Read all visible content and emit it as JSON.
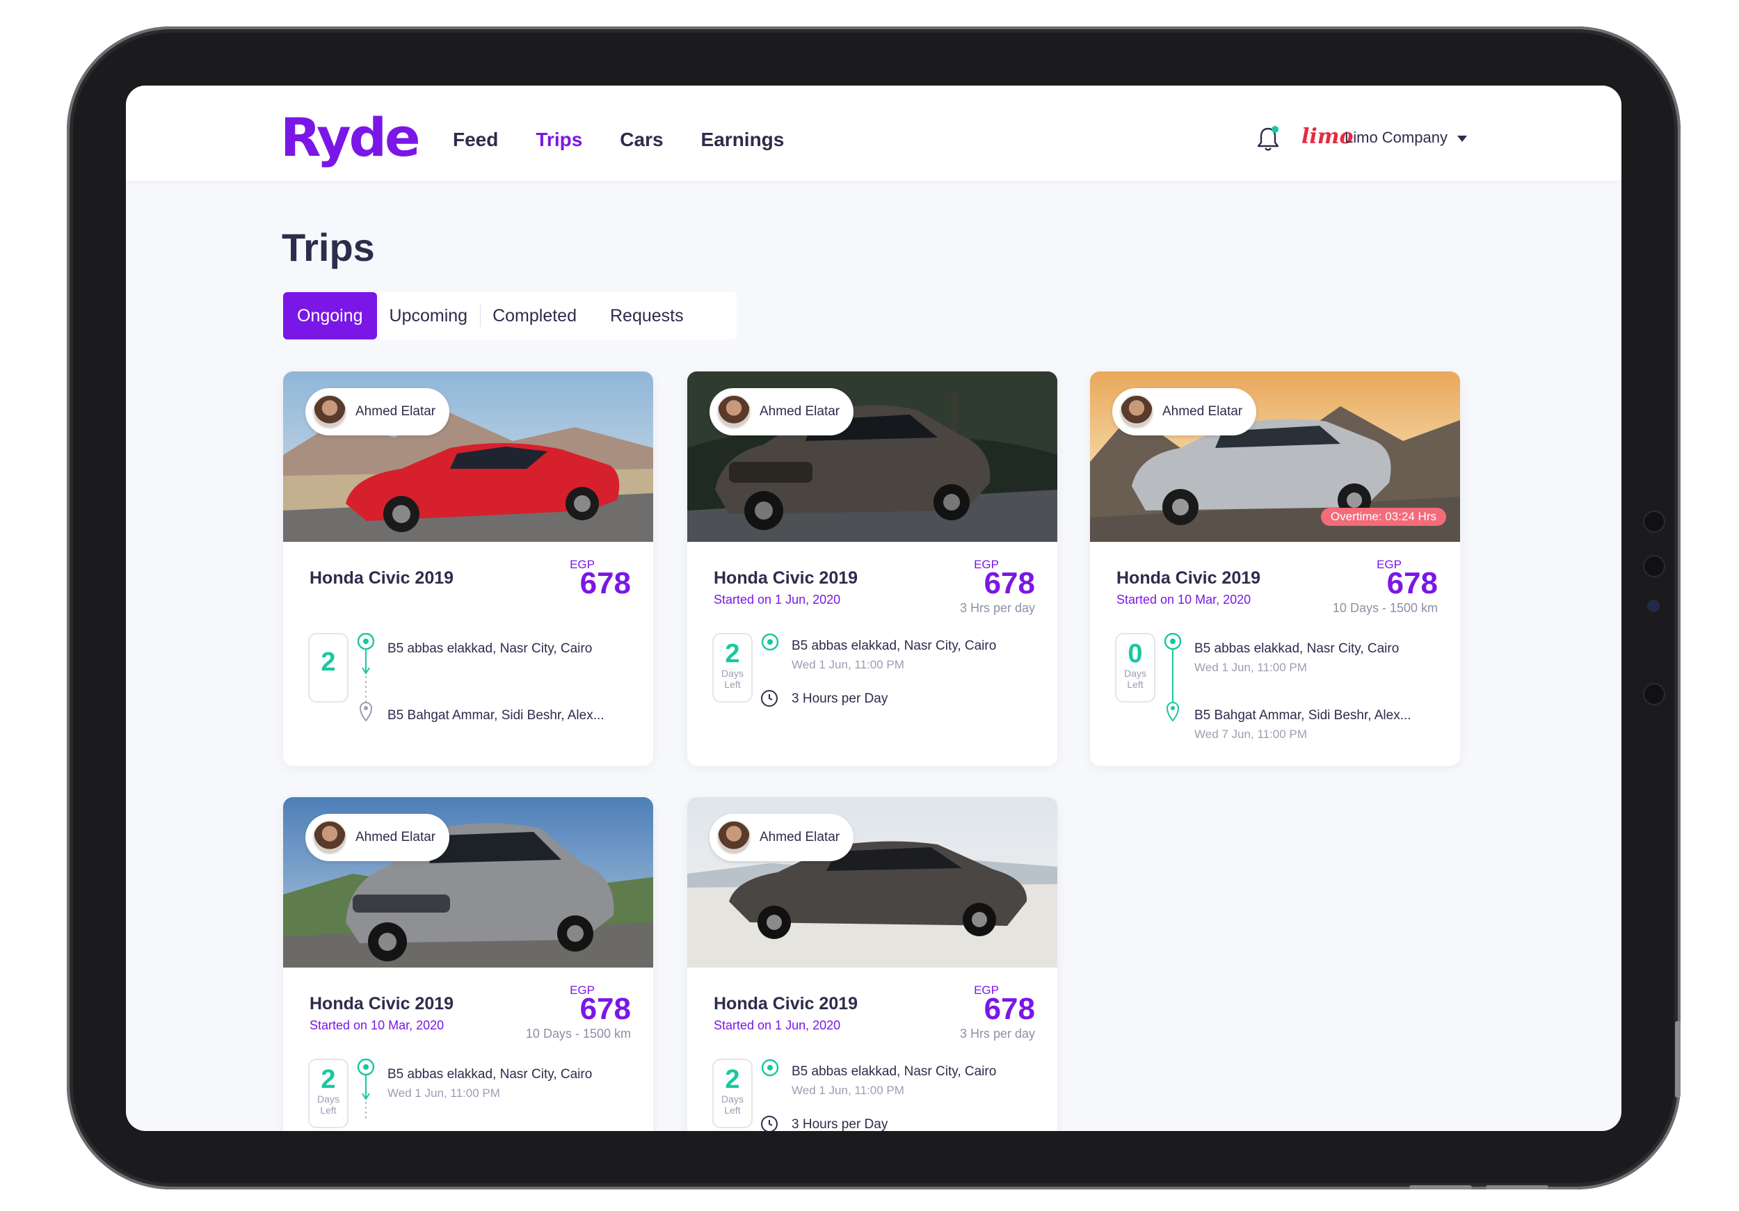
{
  "brand": {
    "logo": "Ryde"
  },
  "nav": {
    "feed": "Feed",
    "trips": "Trips",
    "cars": "Cars",
    "earnings": "Earnings"
  },
  "account": {
    "brand_mark": "limo",
    "company": "Limo Company"
  },
  "page": {
    "title": "Trips"
  },
  "tabs": {
    "ongoing": "Ongoing",
    "upcoming": "Upcoming",
    "completed": "Completed",
    "requests": "Requests"
  },
  "colors": {
    "accent": "#7a17e6",
    "teal": "#18c8a0",
    "overtime": "#f46b7a",
    "text": "#2c2c4c"
  },
  "cards": [
    {
      "driver": "Ahmed Elatar",
      "car": "Honda Civic 2019",
      "started": "",
      "currency": "EGP",
      "price": "678",
      "duration": "",
      "days": "2",
      "days_label_1": "",
      "days_label_2": "",
      "pickup": "B5 abbas elakkad, Nasr City, Cairo",
      "pickup_date": "",
      "dropoff": "B5 Bahgat Ammar, Sidi Beshr, Alex...",
      "dropoff_date": "",
      "overtime": ""
    },
    {
      "driver": "Ahmed Elatar",
      "car": "Honda Civic 2019",
      "started": "Started on 1 Jun, 2020",
      "currency": "EGP",
      "price": "678",
      "duration": "3 Hrs per day",
      "days": "2",
      "days_label_1": "Days",
      "days_label_2": "Left",
      "pickup": "B5 abbas elakkad, Nasr City, Cairo",
      "pickup_date": "Wed 1 Jun, 11:00 PM",
      "hours": "3 Hours per Day"
    },
    {
      "driver": "Ahmed Elatar",
      "car": "Honda Civic 2019",
      "started": "Started on 10 Mar, 2020",
      "currency": "EGP",
      "price": "678",
      "duration": "10 Days - 1500 km",
      "days": "0",
      "days_label_1": "Days",
      "days_label_2": "Left",
      "pickup": "B5 abbas elakkad, Nasr City, Cairo",
      "pickup_date": "Wed 1 Jun, 11:00 PM",
      "dropoff": "B5 Bahgat Ammar, Sidi Beshr, Alex...",
      "dropoff_date": "Wed 7 Jun, 11:00 PM",
      "overtime": "Overtime: 03:24 Hrs"
    },
    {
      "driver": "Ahmed Elatar",
      "car": "Honda Civic 2019",
      "started": "Started on 10 Mar, 2020",
      "currency": "EGP",
      "price": "678",
      "duration": "10 Days - 1500 km",
      "days": "2",
      "days_label_1": "Days",
      "days_label_2": "Left",
      "pickup": "B5 abbas elakkad, Nasr City, Cairo",
      "pickup_date": "Wed 1 Jun, 11:00 PM"
    },
    {
      "driver": "Ahmed Elatar",
      "car": "Honda Civic 2019",
      "started": "Started on 1 Jun, 2020",
      "currency": "EGP",
      "price": "678",
      "duration": "3 Hrs per day",
      "days": "2",
      "days_label_1": "Days",
      "days_label_2": "Left",
      "pickup": "B5 abbas elakkad, Nasr City, Cairo",
      "pickup_date": "Wed 1 Jun, 11:00 PM",
      "hours": "3 Hours per Day"
    }
  ]
}
